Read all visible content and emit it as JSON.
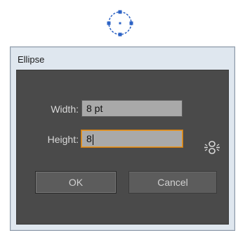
{
  "dialog": {
    "title": "Ellipse",
    "width_label": "Width:",
    "width_value": "8 pt",
    "height_label": "Height:",
    "height_value": "8",
    "ok_label": "OK",
    "cancel_label": "Cancel"
  },
  "icons": {
    "preview": "ellipse-preview-icon",
    "constrain": "constrain-proportions-icon"
  },
  "colors": {
    "dialog_bg": "#4a4a4a",
    "focus_border": "#e49a2e",
    "input_bg": "#a9a9a9",
    "preview_stroke": "#2d63c5"
  }
}
